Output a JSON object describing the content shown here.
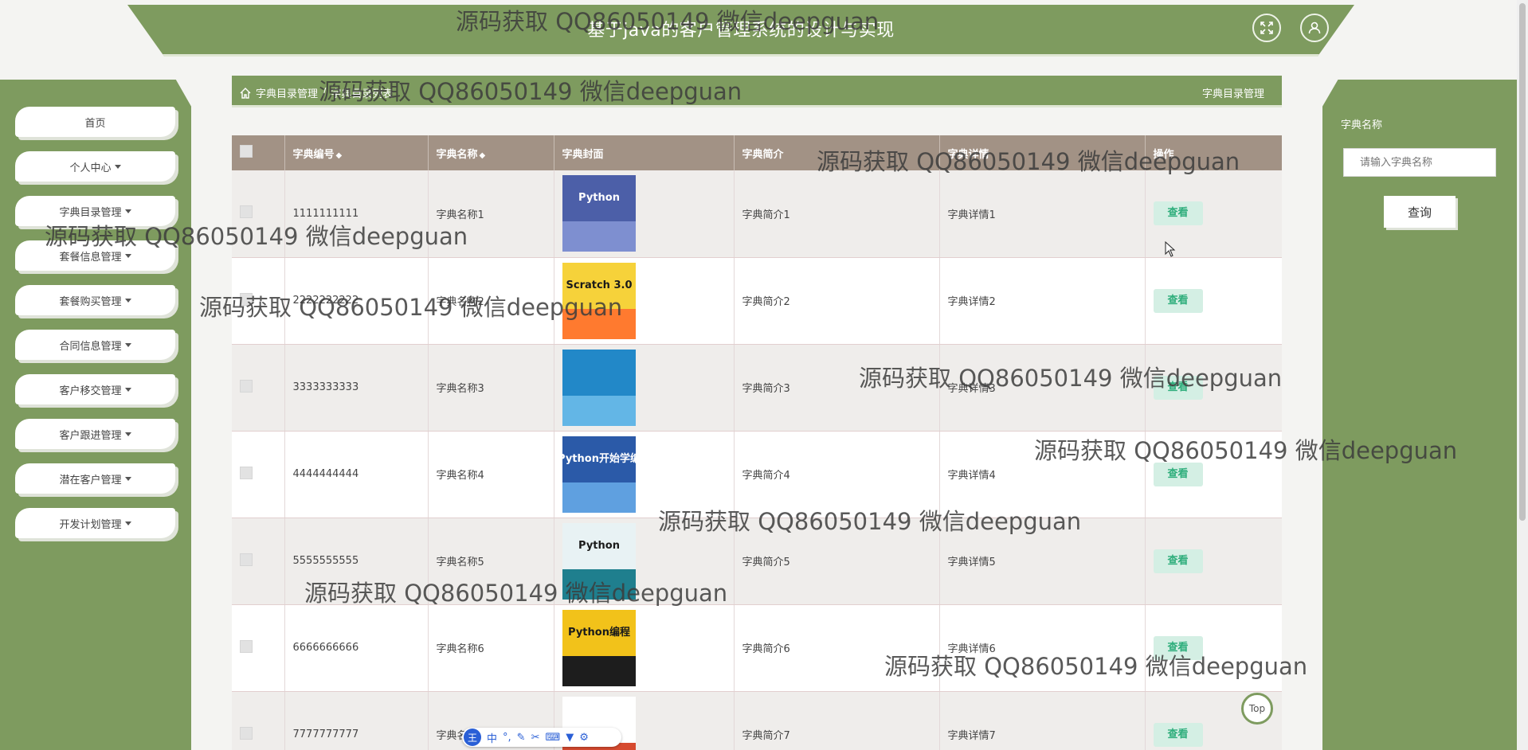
{
  "header": {
    "title": "基于java的客户管理系统的设计与实现",
    "fullscreen_icon": "expand-icon",
    "user_icon": "user-icon"
  },
  "sidebar": {
    "items": [
      {
        "label": "首页",
        "dropdown": false
      },
      {
        "label": "个人中心",
        "dropdown": true
      },
      {
        "label": "字典目录管理",
        "dropdown": true
      },
      {
        "label": "套餐信息管理",
        "dropdown": true
      },
      {
        "label": "套餐购买管理",
        "dropdown": true
      },
      {
        "label": "合同信息管理",
        "dropdown": true
      },
      {
        "label": "客户移交管理",
        "dropdown": true
      },
      {
        "label": "客户跟进管理",
        "dropdown": true
      },
      {
        "label": "潜在客户管理",
        "dropdown": true
      },
      {
        "label": "开发计划管理",
        "dropdown": true
      }
    ]
  },
  "breadcrumb": {
    "home_icon": "home-icon",
    "level1": "字典目录管理",
    "separator": "/",
    "level2": "字典目录列表",
    "right_title": "字典目录管理"
  },
  "table": {
    "headers": {
      "code": "字典编号",
      "name": "字典名称",
      "cover": "字典封面",
      "intro": "字典简介",
      "detail": "字典详情",
      "action": "操作"
    },
    "sort_icon": "◆",
    "view_label": "查看",
    "rows": [
      {
        "code": "1111111111",
        "name": "字典名称1",
        "intro": "字典简介1",
        "detail": "字典详情1",
        "cover_title": "Python"
      },
      {
        "code": "2222222222",
        "name": "字典名称2",
        "intro": "字典简介2",
        "detail": "字典详情2",
        "cover_title": "Scratch 3.0"
      },
      {
        "code": "3333333333",
        "name": "字典名称3",
        "intro": "字典简介3",
        "detail": "字典详情3",
        "cover_title": ""
      },
      {
        "code": "4444444444",
        "name": "字典名称4",
        "intro": "字典简介4",
        "detail": "字典详情4",
        "cover_title": "从Python开始学编程"
      },
      {
        "code": "5555555555",
        "name": "字典名称5",
        "intro": "字典简介5",
        "detail": "字典详情5",
        "cover_title": "Python"
      },
      {
        "code": "6666666666",
        "name": "字典名称6",
        "intro": "字典简介6",
        "detail": "字典详情6",
        "cover_title": "Python编程"
      },
      {
        "code": "7777777777",
        "name": "字典名称7",
        "intro": "字典简介7",
        "detail": "字典详情7",
        "cover_title": ""
      }
    ]
  },
  "search": {
    "label": "字典名称",
    "placeholder": "请输入字典名称",
    "button": "查询"
  },
  "top_button": "Top",
  "ime": {
    "logo": "王",
    "mode": "中"
  },
  "watermark": "源码获取 QQ86050149 微信deepguan",
  "colors": {
    "theme_green": "#7e9b5f",
    "table_header": "#a29285",
    "view_button_bg": "#d4efe4",
    "view_button_text": "#2fae7c"
  }
}
